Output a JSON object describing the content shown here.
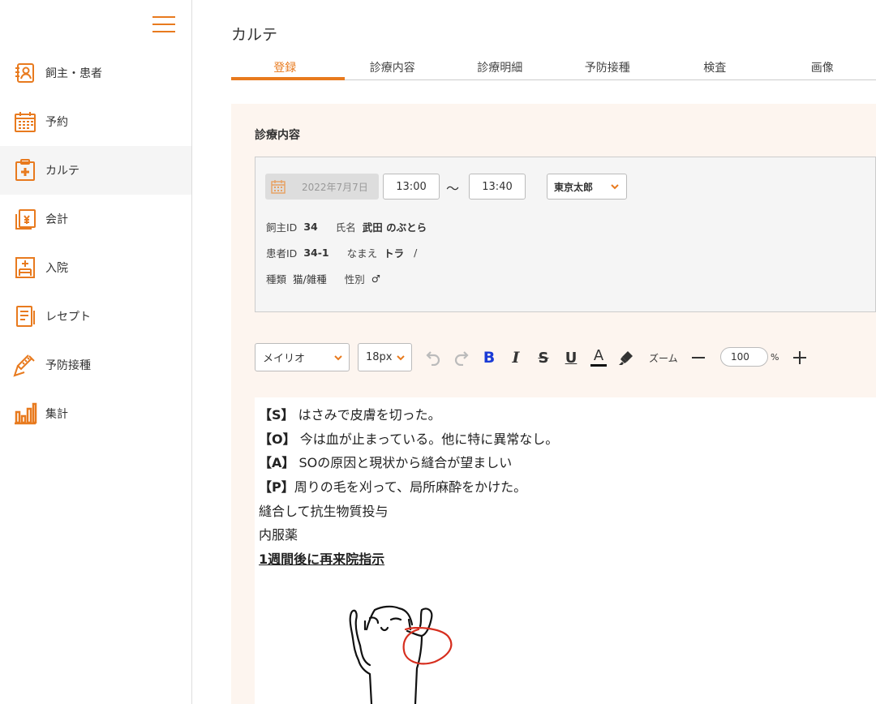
{
  "sidebar": {
    "items": [
      {
        "label": "飼主・患者",
        "icon": "owner-patient-icon"
      },
      {
        "label": "予約",
        "icon": "calendar-icon"
      },
      {
        "label": "カルテ",
        "icon": "chart-record-icon"
      },
      {
        "label": "会計",
        "icon": "accounting-icon"
      },
      {
        "label": "入院",
        "icon": "hospitalization-icon"
      },
      {
        "label": "レセプト",
        "icon": "receipt-icon"
      },
      {
        "label": "予防接種",
        "icon": "syringe-icon"
      },
      {
        "label": "集計",
        "icon": "bar-chart-icon"
      }
    ],
    "active_index": 2,
    "accent": "#e87a1e"
  },
  "header": {
    "title": "カルテ",
    "tabs": [
      "登録",
      "診療内容",
      "診療明細",
      "予防接種",
      "検査",
      "画像"
    ],
    "active_tab": 0
  },
  "record": {
    "section_title": "診療内容",
    "date": "2022年7月7日",
    "start_time": "13:00",
    "tilde": "〜",
    "end_time": "13:40",
    "doctor": "東京太郎",
    "owner_id_label": "飼主ID",
    "owner_id": "34",
    "owner_name_label": "氏名",
    "owner_name": "武田 のぶとら",
    "patient_id_label": "患者ID",
    "patient_id": "34-1",
    "patient_name_label": "なまえ",
    "patient_name": "トラ",
    "patient_name_sep": "/",
    "species_label": "種類",
    "species": "猫/雑種",
    "sex_label": "性別",
    "sex": "♂"
  },
  "toolbar": {
    "font": "メイリオ",
    "size": "18px",
    "zoom_label": "ズーム",
    "zoom_value": "100",
    "zoom_unit": "%"
  },
  "editor": {
    "s_tag": "【S】",
    "s_text": " はさみで皮膚を切った。",
    "o_tag": "【O】",
    "o_text": " 今は血が止まっている。他に特に異常なし。",
    "a_tag": "【A】",
    "a_text": " SOの原因と現状から縫合が望ましい",
    "p_tag": "【P】",
    "p_text": "周りの毛を刈って、局所麻酔をかけた。",
    "line5": "縫合して抗生物質投与",
    "line6": "内服薬",
    "line7": "1週間後に再来院指示"
  }
}
